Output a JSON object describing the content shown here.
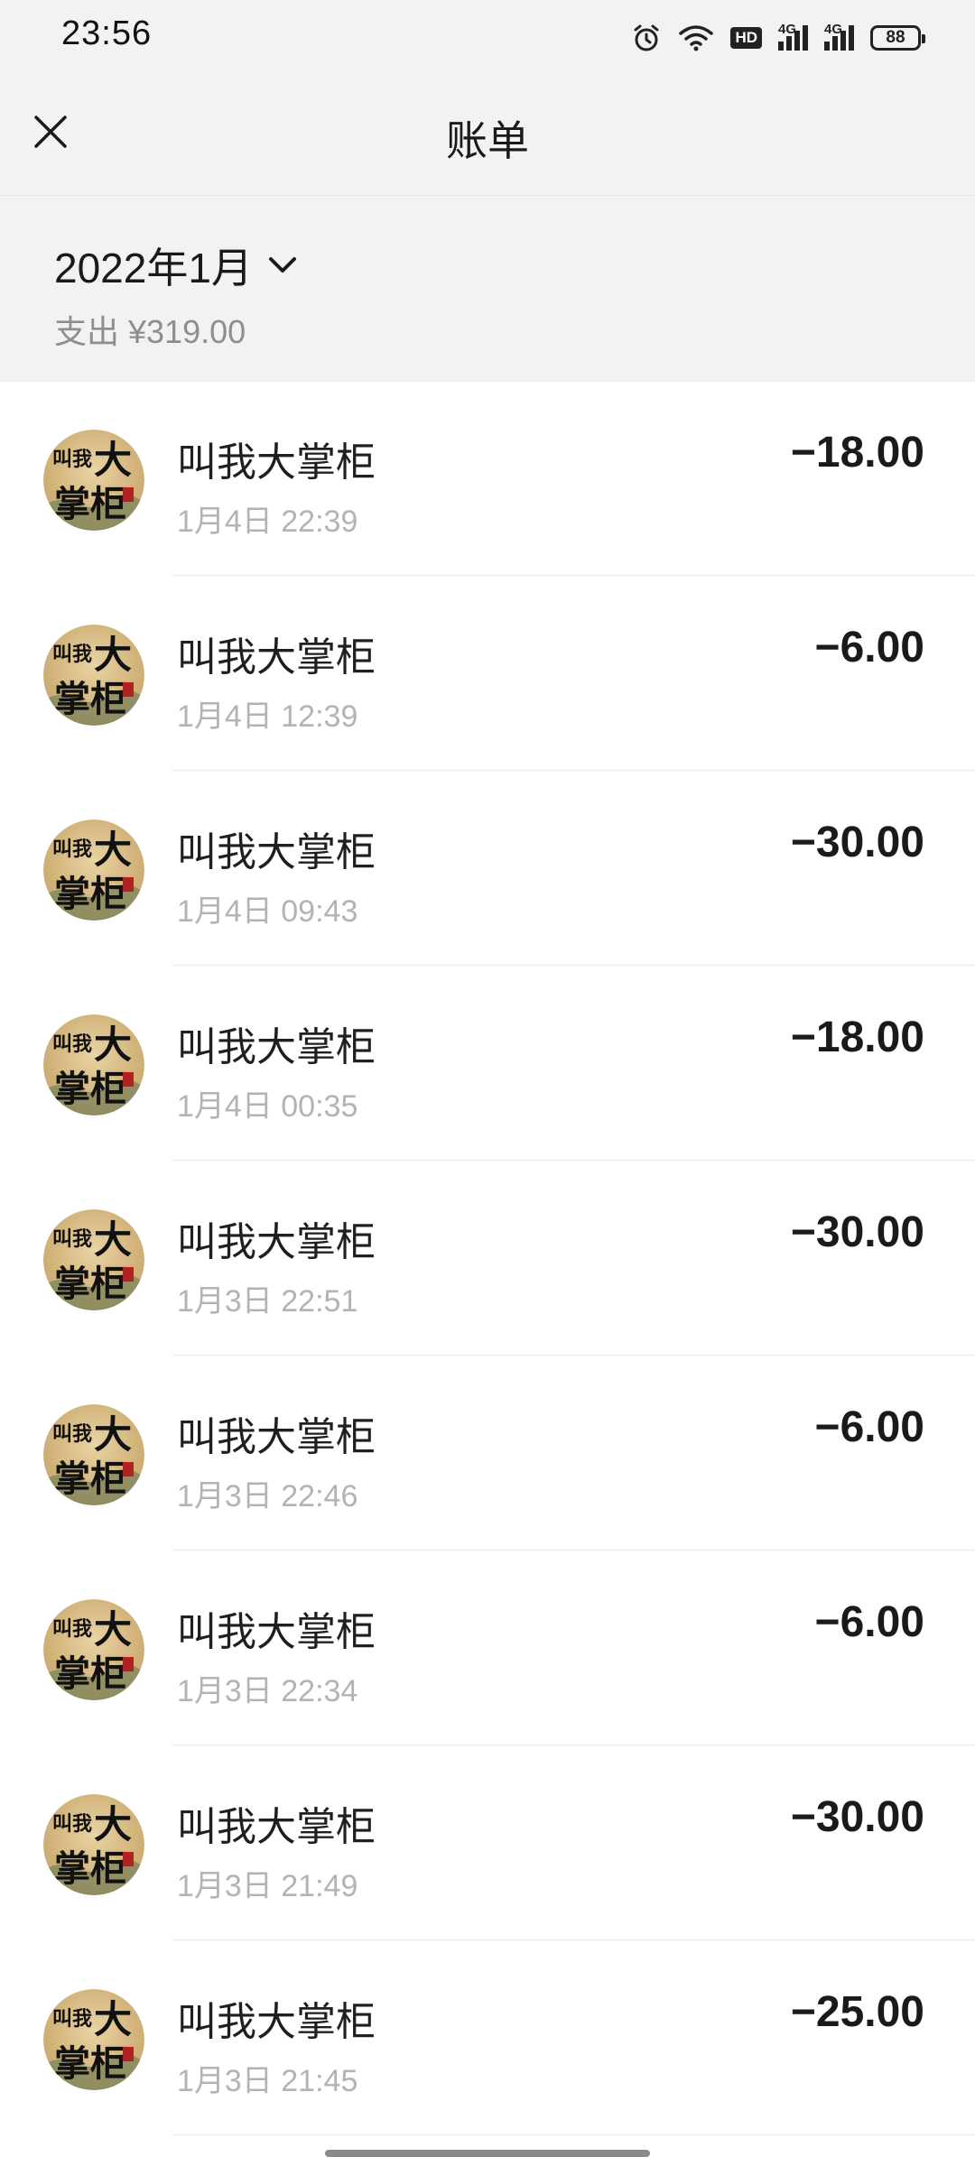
{
  "status_bar": {
    "time": "23:56",
    "net1": "4G",
    "net2": "4G",
    "hd": "HD",
    "battery": "88",
    "icons": [
      "alarm-icon",
      "wifi-icon",
      "hd-icon",
      "signal-4g-icon",
      "signal-4g-icon",
      "battery-icon"
    ]
  },
  "header": {
    "title": "账单",
    "close_icon": "close-icon"
  },
  "summary": {
    "month": "2022年1月",
    "expense": "支出 ¥319.00"
  },
  "transactions": [
    {
      "merchant": "叫我大掌柜",
      "time": "1月4日 22:39",
      "amount": "−18.00"
    },
    {
      "merchant": "叫我大掌柜",
      "time": "1月4日 12:39",
      "amount": "−6.00"
    },
    {
      "merchant": "叫我大掌柜",
      "time": "1月4日 09:43",
      "amount": "−30.00"
    },
    {
      "merchant": "叫我大掌柜",
      "time": "1月4日 00:35",
      "amount": "−18.00"
    },
    {
      "merchant": "叫我大掌柜",
      "time": "1月3日 22:51",
      "amount": "−30.00"
    },
    {
      "merchant": "叫我大掌柜",
      "time": "1月3日 22:46",
      "amount": "−6.00"
    },
    {
      "merchant": "叫我大掌柜",
      "time": "1月3日 22:34",
      "amount": "−6.00"
    },
    {
      "merchant": "叫我大掌柜",
      "time": "1月3日 21:49",
      "amount": "−30.00"
    },
    {
      "merchant": "叫我大掌柜",
      "time": "1月3日 21:45",
      "amount": "−25.00"
    }
  ],
  "avatar_text": {
    "line1": "叫我",
    "big1": "大",
    "big2": "掌柜"
  },
  "colors": {
    "header_bg": "#f2f2f2",
    "muted_text": "#b3b3b3",
    "amount_text": "#1a1a1a"
  }
}
